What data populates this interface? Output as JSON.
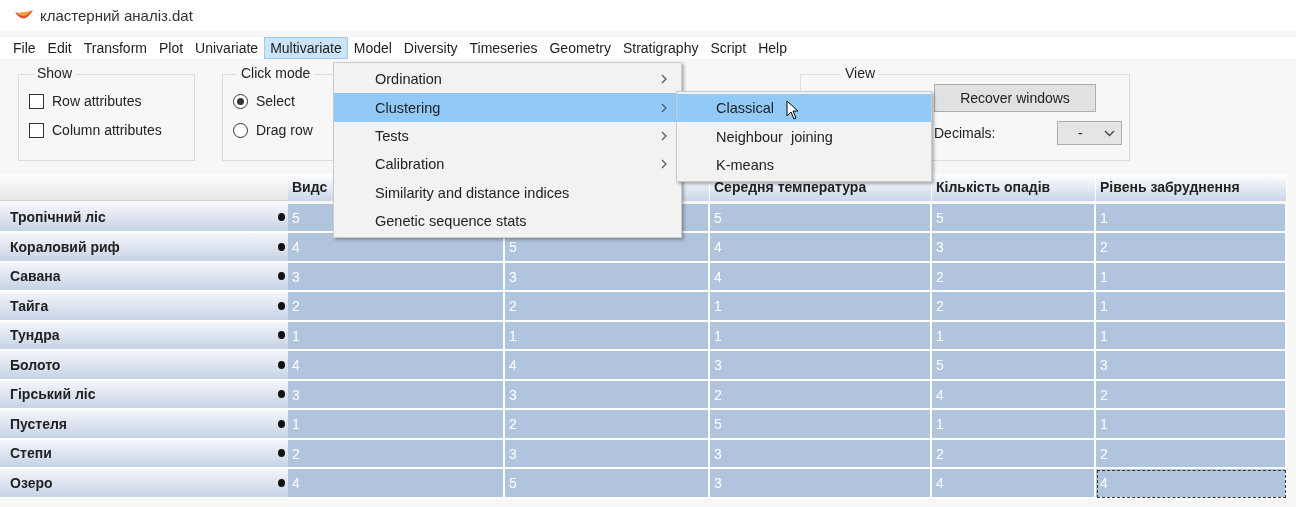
{
  "window": {
    "title": "кластерний аналіз.dat"
  },
  "menubar": [
    {
      "label": "File",
      "selected": false
    },
    {
      "label": "Edit",
      "selected": false
    },
    {
      "label": "Transform",
      "selected": false
    },
    {
      "label": "Plot",
      "selected": false
    },
    {
      "label": "Univariate",
      "selected": false
    },
    {
      "label": "Multivariate",
      "selected": true
    },
    {
      "label": "Model",
      "selected": false
    },
    {
      "label": "Diversity",
      "selected": false
    },
    {
      "label": "Timeseries",
      "selected": false
    },
    {
      "label": "Geometry",
      "selected": false
    },
    {
      "label": "Stratigraphy",
      "selected": false
    },
    {
      "label": "Script",
      "selected": false
    },
    {
      "label": "Help",
      "selected": false
    }
  ],
  "toolbar": {
    "show_group": {
      "title": "Show",
      "checkboxes": [
        {
          "label": "Row attributes",
          "checked": false
        },
        {
          "label": "Column attributes",
          "checked": false
        }
      ]
    },
    "click_mode_group": {
      "title": "Click mode",
      "radios": [
        {
          "label": "Select",
          "selected": true
        },
        {
          "label": "Drag row",
          "selected": false
        }
      ]
    },
    "view_group": {
      "title": "View",
      "button": "Recover windows",
      "decimals_label": "Decimals:",
      "decimals_value": "-"
    }
  },
  "table": {
    "columns": [
      {
        "label": "Видс"
      },
      {},
      {
        "label": "Середня температура"
      },
      {
        "label": "Кількість опадів"
      },
      {
        "label": "Рівень забруднення"
      }
    ],
    "rows": [
      {
        "name": "Тропічний ліс",
        "cells": [
          {
            "value": "5",
            "focused": false
          },
          {
            "focused": false
          },
          {
            "value": "5",
            "focused": false
          },
          {
            "value": "5",
            "focused": false
          },
          {
            "value": "1",
            "focused": false
          }
        ]
      },
      {
        "name": "Кораловий риф",
        "cells": [
          {
            "value": "4",
            "focused": false
          },
          {
            "value": "5",
            "focused": false
          },
          {
            "value": "4",
            "focused": false
          },
          {
            "value": "3",
            "focused": false
          },
          {
            "value": "2",
            "focused": false
          }
        ]
      },
      {
        "name": "Савана",
        "cells": [
          {
            "value": "3",
            "focused": false
          },
          {
            "value": "3",
            "focused": false
          },
          {
            "value": "4",
            "focused": false
          },
          {
            "value": "2",
            "focused": false
          },
          {
            "value": "1",
            "focused": false
          }
        ]
      },
      {
        "name": "Тайга",
        "cells": [
          {
            "value": "2",
            "focused": false
          },
          {
            "value": "2",
            "focused": false
          },
          {
            "value": "1",
            "focused": false
          },
          {
            "value": "2",
            "focused": false
          },
          {
            "value": "1",
            "focused": false
          }
        ]
      },
      {
        "name": "Тундра",
        "cells": [
          {
            "value": "1",
            "focused": false
          },
          {
            "value": "1",
            "focused": false
          },
          {
            "value": "1",
            "focused": false
          },
          {
            "value": "1",
            "focused": false
          },
          {
            "value": "1",
            "focused": false
          }
        ]
      },
      {
        "name": "Болото",
        "cells": [
          {
            "value": "4",
            "focused": false
          },
          {
            "value": "4",
            "focused": false
          },
          {
            "value": "3",
            "focused": false
          },
          {
            "value": "5",
            "focused": false
          },
          {
            "value": "3",
            "focused": false
          }
        ]
      },
      {
        "name": "Гірський ліс",
        "cells": [
          {
            "value": "3",
            "focused": false
          },
          {
            "value": "3",
            "focused": false
          },
          {
            "value": "2",
            "focused": false
          },
          {
            "value": "4",
            "focused": false
          },
          {
            "value": "2",
            "focused": false
          }
        ]
      },
      {
        "name": "Пустеля",
        "cells": [
          {
            "value": "1",
            "focused": false
          },
          {
            "value": "2",
            "focused": false
          },
          {
            "value": "5",
            "focused": false
          },
          {
            "value": "1",
            "focused": false
          },
          {
            "value": "1",
            "focused": false
          }
        ]
      },
      {
        "name": "Степи",
        "cells": [
          {
            "value": "2",
            "focused": false
          },
          {
            "value": "3",
            "focused": false
          },
          {
            "value": "3",
            "focused": false
          },
          {
            "value": "2",
            "focused": false
          },
          {
            "value": "2",
            "focused": false
          }
        ]
      },
      {
        "name": "Озеро",
        "cells": [
          {
            "value": "4",
            "focused": false
          },
          {
            "value": "5",
            "focused": false
          },
          {
            "value": "3",
            "focused": false
          },
          {
            "value": "4",
            "focused": false
          },
          {
            "value": "4",
            "focused": true
          }
        ]
      }
    ]
  },
  "dropdown_menu": {
    "items": [
      {
        "label": "Ordination",
        "has_submenu": true,
        "selected": false
      },
      {
        "label": "Clustering",
        "has_submenu": true,
        "selected": true
      },
      {
        "label": "Tests",
        "has_submenu": true,
        "selected": false
      },
      {
        "label": "Calibration",
        "has_submenu": true,
        "selected": false
      },
      {
        "label": "Similarity and distance indices",
        "has_submenu": false,
        "selected": false
      },
      {
        "label": "Genetic sequence stats",
        "has_submenu": false,
        "selected": false
      }
    ]
  },
  "submenu": {
    "items": [
      {
        "label": "Classical",
        "selected": true
      },
      {
        "label": "Neighbour  joining",
        "selected": false
      },
      {
        "label": "K-means",
        "selected": false
      }
    ]
  }
}
